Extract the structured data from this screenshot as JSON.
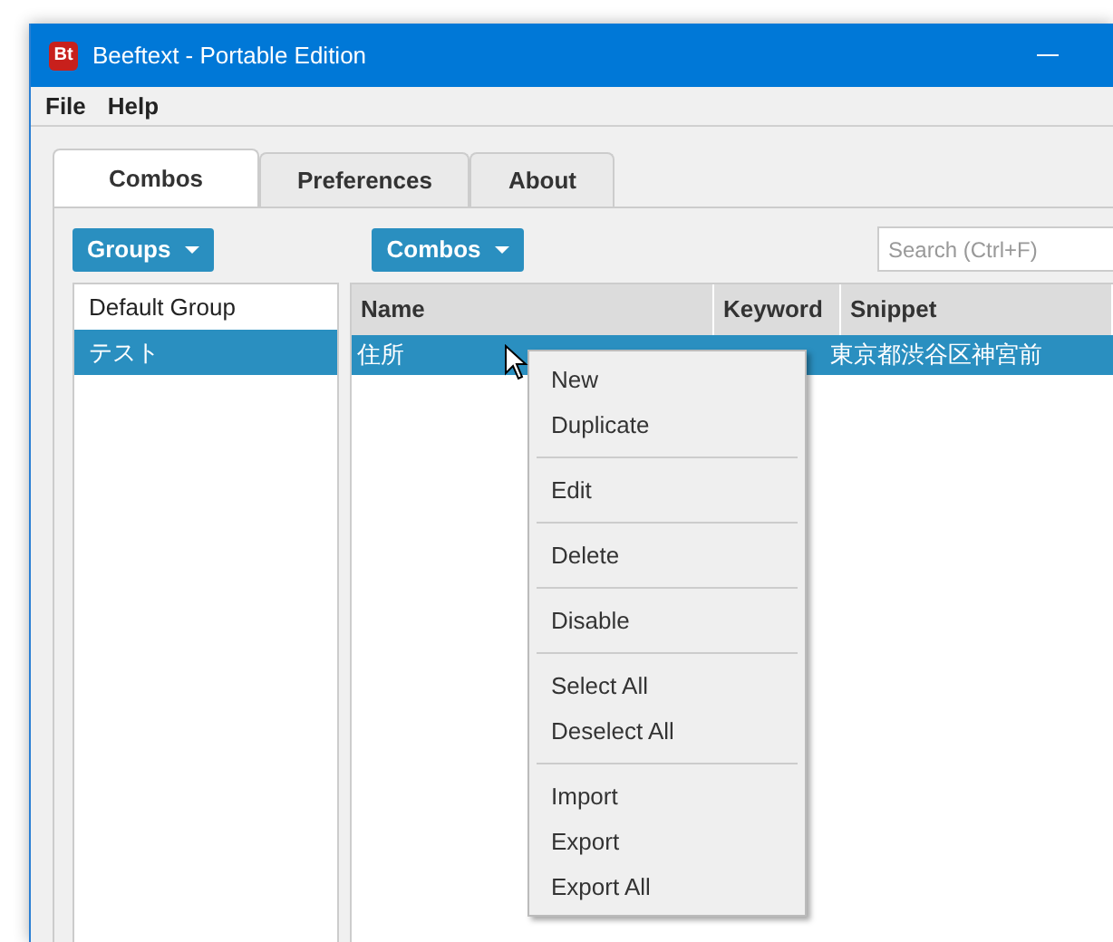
{
  "window": {
    "title": "Beeftext - Portable Edition",
    "logo": "Bt"
  },
  "menu": [
    "File",
    "Help"
  ],
  "tabs": [
    {
      "label": "Combos",
      "selected": true
    },
    {
      "label": "Preferences",
      "selected": false
    },
    {
      "label": "About",
      "selected": false
    }
  ],
  "groups_button": "Groups",
  "combos_button": "Combos",
  "search": {
    "placeholder": "Search (Ctrl+F)"
  },
  "groups": [
    {
      "label": "Default Group",
      "selected": false
    },
    {
      "label": "テスト",
      "selected": true
    }
  ],
  "table": {
    "columns": [
      "Name",
      "Keyword",
      "Snippet"
    ],
    "rows": [
      {
        "name": "住所",
        "snippet": "東京都渋谷区神宮前",
        "selected": true
      }
    ]
  },
  "context_menu": [
    {
      "kind": "item",
      "label": "New"
    },
    {
      "kind": "item",
      "label": "Duplicate"
    },
    {
      "kind": "separator"
    },
    {
      "kind": "item",
      "label": "Edit"
    },
    {
      "kind": "separator"
    },
    {
      "kind": "item",
      "label": "Delete"
    },
    {
      "kind": "separator"
    },
    {
      "kind": "item",
      "label": "Disable"
    },
    {
      "kind": "separator"
    },
    {
      "kind": "item",
      "label": "Select All"
    },
    {
      "kind": "item",
      "label": "Deselect All"
    },
    {
      "kind": "separator"
    },
    {
      "kind": "item",
      "label": "Import"
    },
    {
      "kind": "item",
      "label": "Export"
    },
    {
      "kind": "item",
      "label": "Export All"
    }
  ]
}
